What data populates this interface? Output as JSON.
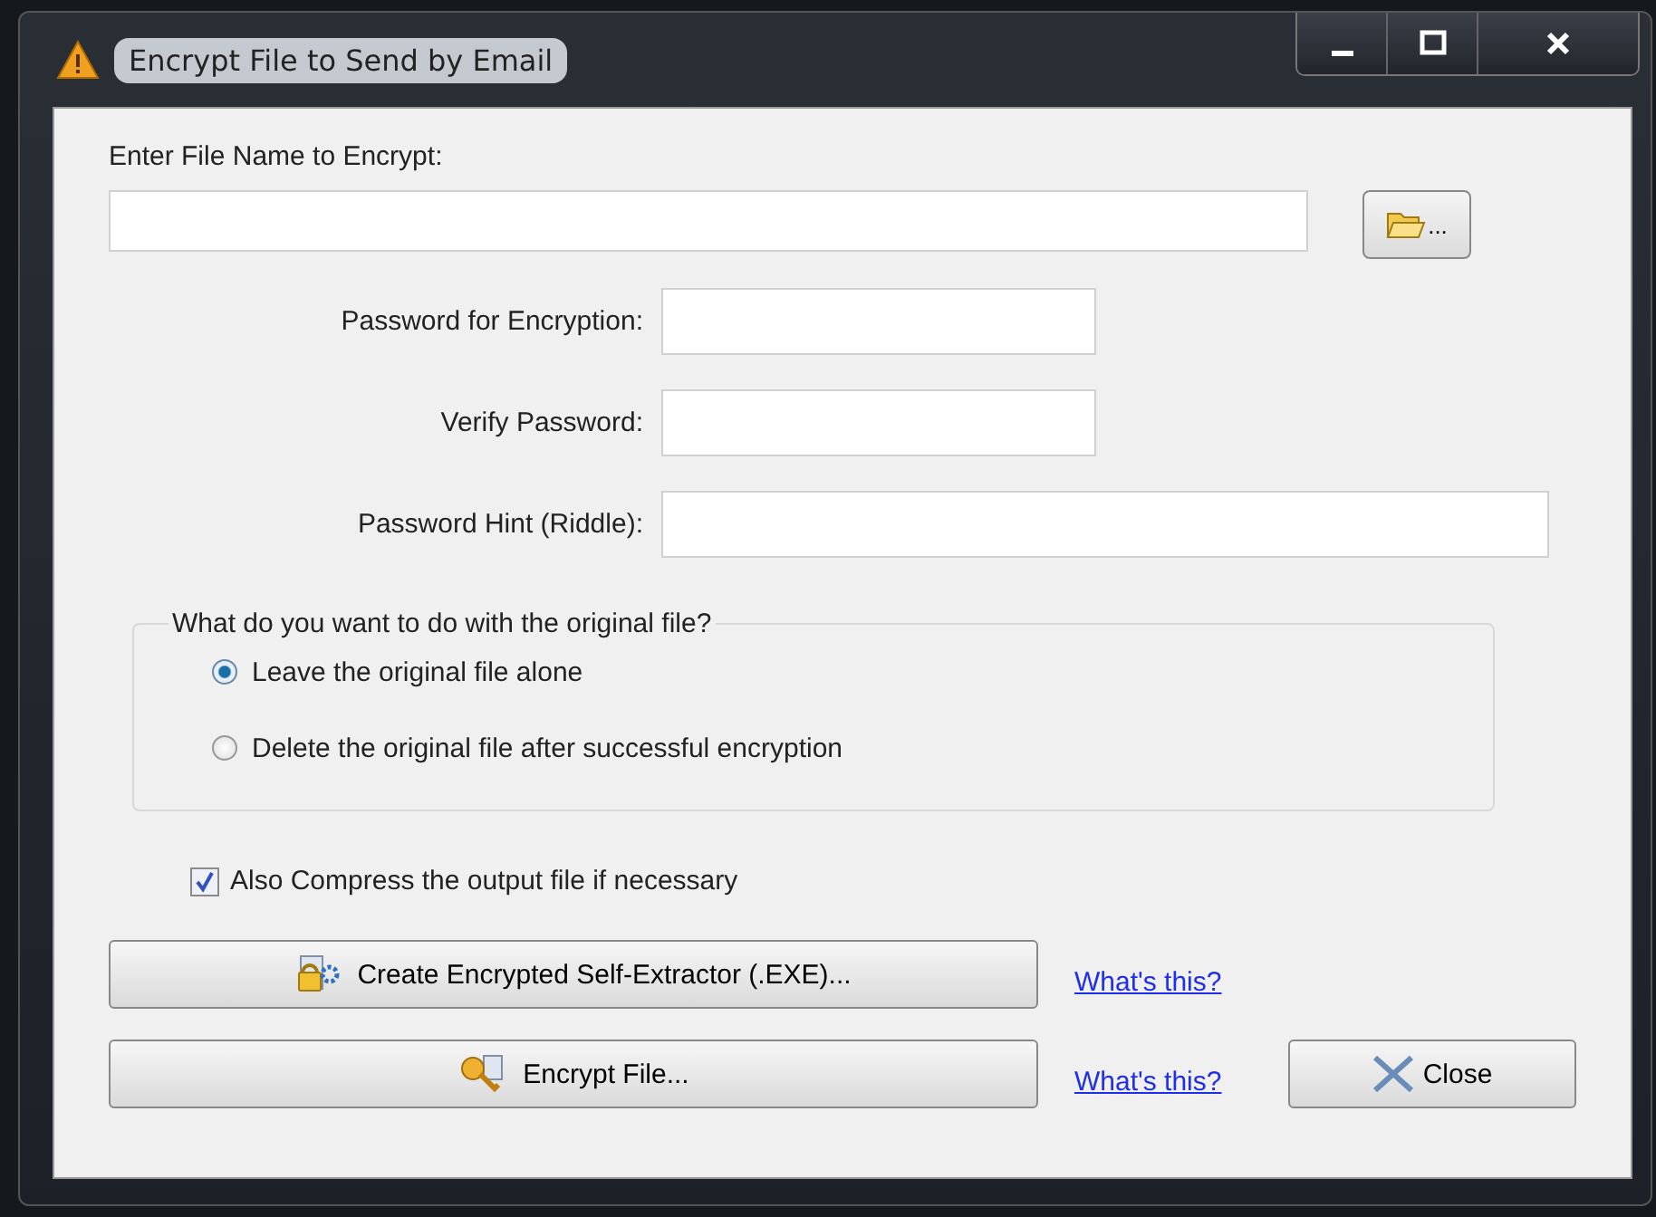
{
  "window": {
    "title": "Encrypt File to Send by Email"
  },
  "file": {
    "label": "Enter File Name to Encrypt:",
    "browse_label": "..."
  },
  "fields": [
    {
      "label": "Password for Encryption:",
      "kind": "short"
    },
    {
      "label": "Verify Password:",
      "kind": "short"
    },
    {
      "label": "Password Hint (Riddle):",
      "kind": "long"
    }
  ],
  "original_file_group": {
    "legend": "What do you want to do with the original file?",
    "options": [
      {
        "label": "Leave the original file alone",
        "selected": true
      },
      {
        "label": "Delete the original file after successful encryption",
        "selected": false
      }
    ]
  },
  "compress": {
    "label": "Also Compress the output file if necessary",
    "checked": true
  },
  "actions": [
    {
      "label": "Create Encrypted Self-Extractor (.EXE)...",
      "kind": "extractor",
      "link": "What's this?"
    },
    {
      "label": "Encrypt File...",
      "kind": "encrypt",
      "link": "What's this?"
    }
  ],
  "close_button": {
    "label": "Close"
  }
}
